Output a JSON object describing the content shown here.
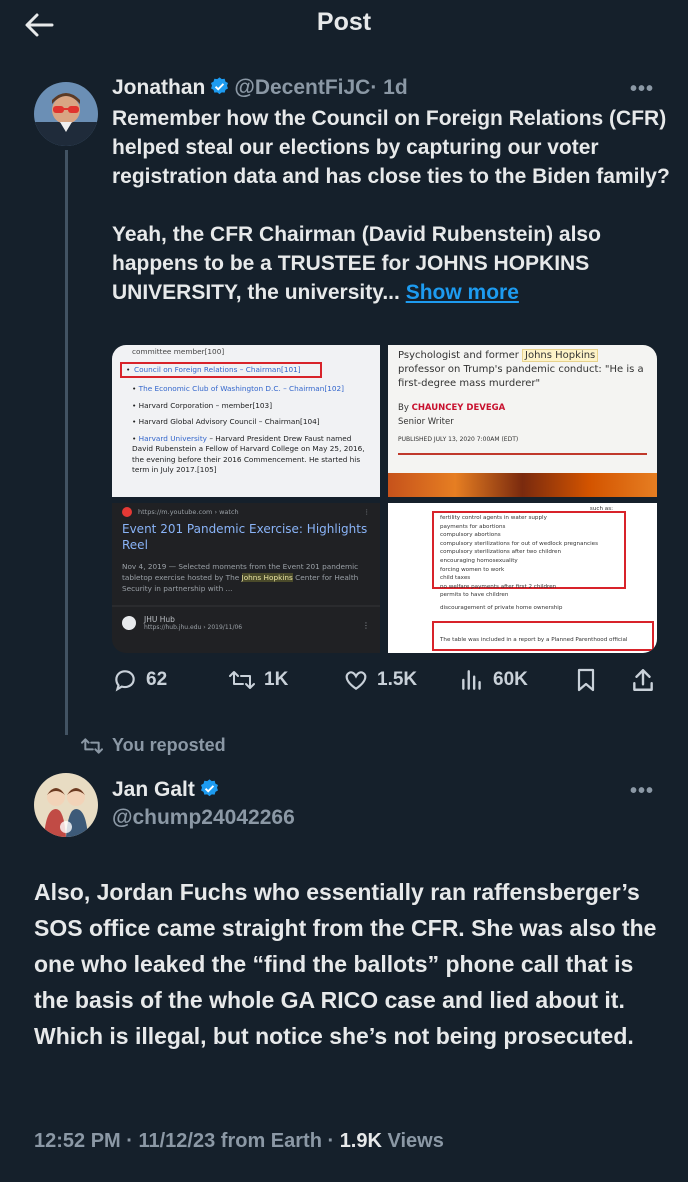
{
  "header": {
    "title": "Post"
  },
  "tweet1": {
    "name": "Jonathan",
    "handle": "@DecentFiJC",
    "time": "· 1d",
    "text_p1": "Remember how the Council on Foreign Relations (CFR) helped steal our elections by capturing our voter registration data and has close ties to the Biden family?",
    "text_p2": "Yeah, the CFR Chairman (David Rubenstein) also happens to be a TRUSTEE for JOHNS HOPKINS UNIVERSITY, the university...",
    "show_more": "Show more",
    "media": {
      "wiki": {
        "line0": "committee member[100]",
        "line1": "Council on Foreign Relations – Chairman[101]",
        "line2": "The Economic Club of Washington D.C. – Chairman[102]",
        "line3": "Harvard Corporation – member[103]",
        "line4": "Harvard Global Advisory Council – Chairman[104]",
        "line5a": "Harvard University",
        "line5b": " – Harvard President Drew Faust named David Rubenstein a Fellow of Harvard College on May 25, 2016, the evening before their 2016 Commencement. He started his term in July 2017.[105]"
      },
      "article": {
        "line1a": "Psychologist and former ",
        "line1b": "Johns Hopkins",
        "line2": "professor on Trump's pandemic conduct: \"He is a first-degree mass murderer\"",
        "by": "By ",
        "author": "CHAUNCEY DEVEGA",
        "role": "Senior Writer",
        "published": "PUBLISHED JULY 13, 2020 7:00AM (EDT)"
      },
      "video": {
        "url": "https://m.youtube.com › watch",
        "title": "Event 201 Pandemic Exercise: Highlights Reel",
        "desc_a": "Nov 4, 2019 — Selected moments from the Event 201 pandemic tabletop exercise hosted by The ",
        "desc_hl": "Johns Hopkins",
        "desc_b": " Center for Health Security in partnership with ...",
        "source": "JHU Hub",
        "source_url": "https://hub.jhu.edu › 2019/11/06"
      },
      "doc": {
        "header": "such as:",
        "items": [
          "fertility control agents in water supply",
          "payments for abortions",
          "compulsory abortions",
          "compulsory sterilizations for out of wedlock pregnancies",
          "compulsory sterilizations after two children",
          "encouraging homosexuality",
          "forcing women to work",
          "child taxes",
          "no welfare payments after first 2 children",
          "permits to have children",
          "discouragement of private home ownership"
        ],
        "caption": "The table was included in a report by a Planned Parenthood official"
      }
    },
    "actions": {
      "replies": "62",
      "reposts": "1K",
      "likes": "1.5K",
      "views": "60K"
    }
  },
  "repost_label": "You reposted",
  "tweet2": {
    "name": "Jan Galt",
    "handle": "@chump24042266",
    "text": "Also, Jordan Fuchs who essentially ran raffensberger’s SOS office came straight from the CFR. She was also the one who leaked the “find the ballots” phone call that is the basis of the whole GA RICO case and lied about it. Which is illegal, but notice she’s not being prosecuted.",
    "time": "12:52 PM · 11/12/23 from Earth · ",
    "views_count": "1.9K",
    "views_label": " Views"
  },
  "colors": {
    "bg": "#15202b",
    "accent": "#1d9bf0",
    "muted": "#8b98a5"
  }
}
